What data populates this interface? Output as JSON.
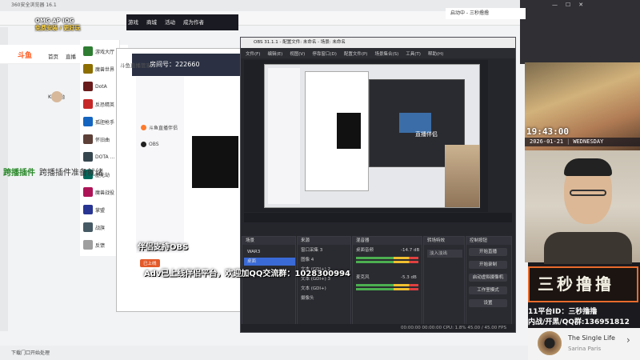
{
  "browser": {
    "title": "360安全浏览器 16.1",
    "logo": "斗鱼",
    "nav": [
      "首页",
      "直播"
    ],
    "sidebar_items": [
      {
        "label": "游戏大厅",
        "color": "#2e7d32"
      },
      {
        "label": "魔兽世界",
        "color": "#8d6e00"
      },
      {
        "label": "DotA",
        "color": "#6a1b1b"
      },
      {
        "label": "反恐精英",
        "color": "#c62828"
      },
      {
        "label": "孤胆枪手",
        "color": "#1565c0"
      },
      {
        "label": "怀旧曲",
        "color": "#5d4037"
      },
      {
        "label": "DOTA OMG",
        "color": "#37474f"
      },
      {
        "label": "虚无劫",
        "color": "#00695c"
      },
      {
        "label": "魔兽战役",
        "color": "#ad1457"
      },
      {
        "label": "掌盟",
        "color": "#283593"
      },
      {
        "label": "战旗",
        "color": "#455a64"
      },
      {
        "label": "反馈",
        "color": "#9e9e9e"
      }
    ],
    "plugin_ready": "跨播插件准备就绪",
    "plugin_label": "跨播插件",
    "kk": "KK平台",
    "status_left": "下载门口开始处理"
  },
  "game": {
    "tabs": [
      "游戏",
      "商城",
      "活动",
      "成为作者"
    ],
    "title_hint": "战网对战平台"
  },
  "helper": {
    "title": "斗鱼直播管家",
    "room_label": "房间号：",
    "room_number": "222660",
    "items": [
      "斗鱼直播伴侣",
      "OBS"
    ],
    "chat_hint": "斗鱼直播伴侣"
  },
  "obs": {
    "title": "OBS 31.1.1 - 配置文件: 未命名 - 场景: 未命名",
    "menu": [
      "文件(F)",
      "编辑(E)",
      "视图(V)",
      "停靠窗口(D)",
      "配置文件(P)",
      "场景集合(S)",
      "工具(T)",
      "帮助(H)"
    ],
    "preview_label": "直播伴侣",
    "scene_dock_title": "场景",
    "scenes": [
      "WAR3",
      "桌面"
    ],
    "sources_dock_title": "来源",
    "sources": [
      "窗口采集 3",
      "图像 4",
      "文本 (GDI+) 2",
      "文本 (GDI+) 3",
      "文本 (GDI+)",
      "摄像头"
    ],
    "mixer_dock_title": "混音器",
    "mixer_channels": [
      {
        "name": "桌面音频",
        "db": "-14.7 dB"
      },
      {
        "name": "麦克风",
        "db": "-5.3 dB"
      }
    ],
    "transitions_title": "转场特效",
    "transition": "淡入淡出",
    "controls_title": "控制按钮",
    "controls": [
      "开始直播",
      "开始录制",
      "启动虚拟摄像机",
      "工作室模式",
      "设置"
    ],
    "status": "00:00:00  00:00:00  CPU: 1.8%  45.00 / 45.00 FPS"
  },
  "overlay": {
    "cocos_line1": "OMG AP IOG",
    "cocos_line2": "免费安装 / 更好玩",
    "plugin_support": "伴侣支持OBS",
    "online_badge": "已上线",
    "qq_line": "Adv已上线伴侣平台，欢迎加QQ交流群：1028300994"
  },
  "webcam": {
    "window_title": "启动中 - 三秒撸撸",
    "time": "19:43:00",
    "date": "2026-01-21",
    "weekday": "WEDNESDAY",
    "streamer_name": "三秒撸撸",
    "platform_id": "11平台ID：三秒撸撸",
    "contact": "内战/开黑/QQ群:136951812",
    "music_title": "The Single Life",
    "music_artist": "Sarina Paris",
    "next_glyph": "›"
  }
}
